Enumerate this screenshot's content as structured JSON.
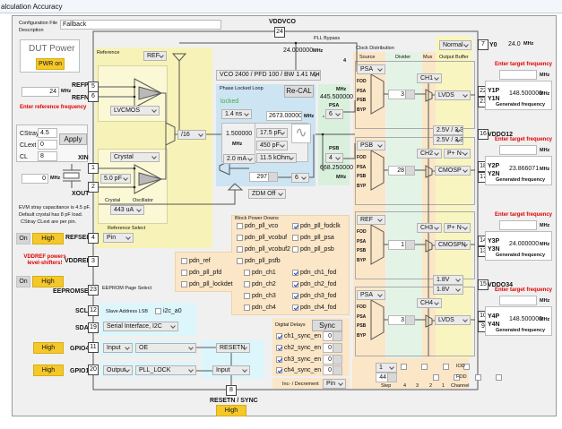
{
  "window": {
    "title": "alculation Accuracy"
  },
  "config": {
    "file_label": "Configuration File",
    "description_label": "Description",
    "file_value": "Fallback"
  },
  "dut": {
    "title": "DUT Power",
    "pwr_button": "PWR on"
  },
  "reference": {
    "freq_value": "24",
    "freq_unit": "MHz",
    "enter_freq": "Enter reference frequency",
    "panel_label": "Reference",
    "ref_select": "REF",
    "input_type": "LVCMOS",
    "source_type": "Crystal",
    "cap": "5.0 pF",
    "crystal_label": "Crystal",
    "oscillator_label": "Oscillator",
    "drive": "443 uA",
    "divider": "/16",
    "select_label": "Reference Select",
    "select_value": "Pin",
    "xtal_freq": "0",
    "xtal_unit": "MHz",
    "cstray_label": "CStray",
    "cstray": "4.5",
    "clext_label": "CLext",
    "clext": "0",
    "cl_label": "CL",
    "cl": "8",
    "apply": "Apply",
    "note1": "EVM stray capacitance is 4.5 pF.",
    "note2": "Default crystal has 8 pF load.",
    "note3": "CStray CLext are per pin."
  },
  "pins": {
    "vddvco": {
      "name": "VDDVCO",
      "num": "24"
    },
    "refp": {
      "name": "REFP",
      "num": "5"
    },
    "refn": {
      "name": "REFN",
      "num": "6"
    },
    "xin": {
      "name": "XIN",
      "num": "1"
    },
    "xout": {
      "name": "XOUT",
      "num": "2"
    },
    "refsel": {
      "name": "REFSEL",
      "num": "4"
    },
    "vddref": {
      "name": "VDDREF",
      "num": "3"
    },
    "eepromsel": {
      "name": "EEPROMSEL",
      "num": "23"
    },
    "scl": {
      "name": "SCL",
      "num": "12"
    },
    "sda": {
      "name": "SDA",
      "num": "19"
    },
    "gpio4": {
      "name": "GPIO4",
      "num": "11"
    },
    "gpio1": {
      "name": "GPIO1",
      "num": "20"
    },
    "resetn": {
      "name": "RESETN / SYNC",
      "num": "8"
    },
    "y0": {
      "name": "Y0",
      "num": "7"
    },
    "y1p": {
      "num": "22"
    },
    "y1n": {
      "num": "21"
    },
    "vddo12": {
      "name": "VDDO12",
      "num": "16"
    },
    "y2p": {
      "num": "18"
    },
    "y2n": {
      "num": "17"
    },
    "y3p": {
      "num": "14"
    },
    "y3n": {
      "num": "13"
    },
    "vddo34": {
      "name": "VDDO34",
      "num": "15"
    },
    "y4p": {
      "num": "10"
    },
    "y4n": {
      "num": "9"
    }
  },
  "controls": {
    "refsel_on": "On",
    "refsel_high": "High",
    "vddref_warning": "VDDREF powers level-shifters!",
    "eeprom_on": "On",
    "eeprom_high": "High",
    "eeprom_label": "EEPROM Page Select",
    "slave_label": "Slave Address LSB",
    "i2c_a0": "i2c_a0",
    "serial_interface": "Serial Interface, I2C",
    "gpio4_high": "High",
    "gpio4_dir": "Input",
    "gpio4_func": "OE",
    "gpio1_high": "High",
    "gpio1_dir": "Output",
    "gpio1_func": "PLL_LOCK",
    "resetn_func": "RESETN",
    "resetn_dir": "Input",
    "resetn_high": "High"
  },
  "pll": {
    "vco_select": "VCO 2400 / PFD 100 / BW 1.41 MHz",
    "bypass_freq": "24.000000",
    "bypass_unit": "MHz",
    "bypass_label": "PLL Bypass",
    "panel_label": "Phase Locked Loop",
    "recal": "Re-CAL",
    "status": "locked",
    "delay": "1.4 ns",
    "vco_freq": "2673.000000",
    "vco_unit": "MHz",
    "pfd_freq": "1.500000",
    "pfd_unit": "MHz",
    "cp_current": "2.0 mA",
    "c1": "17.5 pF",
    "c2": "450 pF",
    "r": "11.5 kOhm",
    "fb_div": "297",
    "fb_pre": "6",
    "zdm": "ZDM Off",
    "psa_unit": "MHz",
    "psa_freq": "445.500000",
    "psa_label": "PSA",
    "psa_div": "6",
    "psb_label": "PSB",
    "psb_div": "4",
    "psb_freq": "668.250000",
    "psb_unit": "MHz",
    "status_color": "#3cb043"
  },
  "dist": {
    "label": "Clock Distribution",
    "bus": "4",
    "col_source": "Source",
    "col_divider": "Divider",
    "col_mux": "Mux",
    "col_output": "Output Buffer",
    "y0_mode": "Normal",
    "y0_freq": "24.0",
    "y0_unit": "MHz",
    "vddo12_a": "2.5V / 3.3V",
    "vddo12_b": "2.5V / 3.3V",
    "vddo34_a": "1.8V",
    "vddo34_b": "1.8V",
    "inputs": [
      "FOD",
      "PSA",
      "PSB",
      "BYP"
    ],
    "channels": [
      {
        "source": "PSA",
        "divider": "3",
        "mux": "CH1",
        "format": "LVDS",
        "p": "Y1P",
        "n": "Y1N",
        "freq": "148.500000"
      },
      {
        "source": "PSB",
        "divider": "28",
        "mux": "CH2",
        "polarity": "P+ N-",
        "format": "CMOSP",
        "p": "Y2P",
        "n": "Y2N",
        "freq": "23.866071"
      },
      {
        "source": "REF",
        "divider": "1",
        "mux": "CH3",
        "polarity": "P+ N-",
        "format": "CMOSPN",
        "p": "Y3P",
        "n": "Y3N",
        "freq": "24.000000"
      },
      {
        "source": "PSA",
        "divider": "3",
        "mux": "CH4",
        "format": "LVDS",
        "p": "Y4P",
        "n": "Y4N",
        "freq": "148.500000"
      }
    ],
    "enter_target": "Enter target frequency",
    "target_unit": "MHz",
    "freq_unit": "MHz",
    "generated": "Generated frequency",
    "step_select": "1",
    "step_value": "44",
    "iod": "IOD",
    "fod": "FOD",
    "step": "Step",
    "ch4": "4",
    "ch3": "3",
    "ch2": "2",
    "ch1": "1",
    "channel": "Channel"
  },
  "powerdowns": {
    "label": "Block Power Downs",
    "items": [
      {
        "label": "pdn_pll_vco",
        "checked": false
      },
      {
        "label": "pdn_pll_vcobuf",
        "checked": false
      },
      {
        "label": "pdn_pll_vcobuf2",
        "checked": false
      },
      {
        "label": "pdn_pll_psfb",
        "checked": false
      },
      {
        "label": "pdn_ref",
        "checked": false
      },
      {
        "label": "pdn_pll_pfd",
        "checked": false
      },
      {
        "label": "pdn_pll_lockdet",
        "checked": false
      },
      {
        "label": "pdn_ch1",
        "checked": false
      },
      {
        "label": "pdn_ch2",
        "checked": false
      },
      {
        "label": "pdn_ch3",
        "checked": false
      },
      {
        "label": "pdn_ch4",
        "checked": false
      },
      {
        "label": "pdn_pll_fodclk",
        "checked": true
      },
      {
        "label": "pdn_pll_psa",
        "checked": false
      },
      {
        "label": "pdn_pll_psb",
        "checked": false
      },
      {
        "label": "pdn_ch1_fod",
        "checked": true
      },
      {
        "label": "pdn_ch2_fod",
        "checked": true
      },
      {
        "label": "pdn_ch3_fod",
        "checked": true
      },
      {
        "label": "pdn_ch4_fod",
        "checked": true
      }
    ]
  },
  "delays": {
    "label": "Digital Delays",
    "sync": "Sync",
    "rows": [
      {
        "label": "ch1_sync_en",
        "value": "0"
      },
      {
        "label": "ch2_sync_en",
        "value": "0"
      },
      {
        "label": "ch3_sync_en",
        "value": "0"
      },
      {
        "label": "ch4_sync_en",
        "value": "0"
      }
    ],
    "incdec_label": "Inc- / Decrement",
    "incdec_value": "Pin"
  }
}
